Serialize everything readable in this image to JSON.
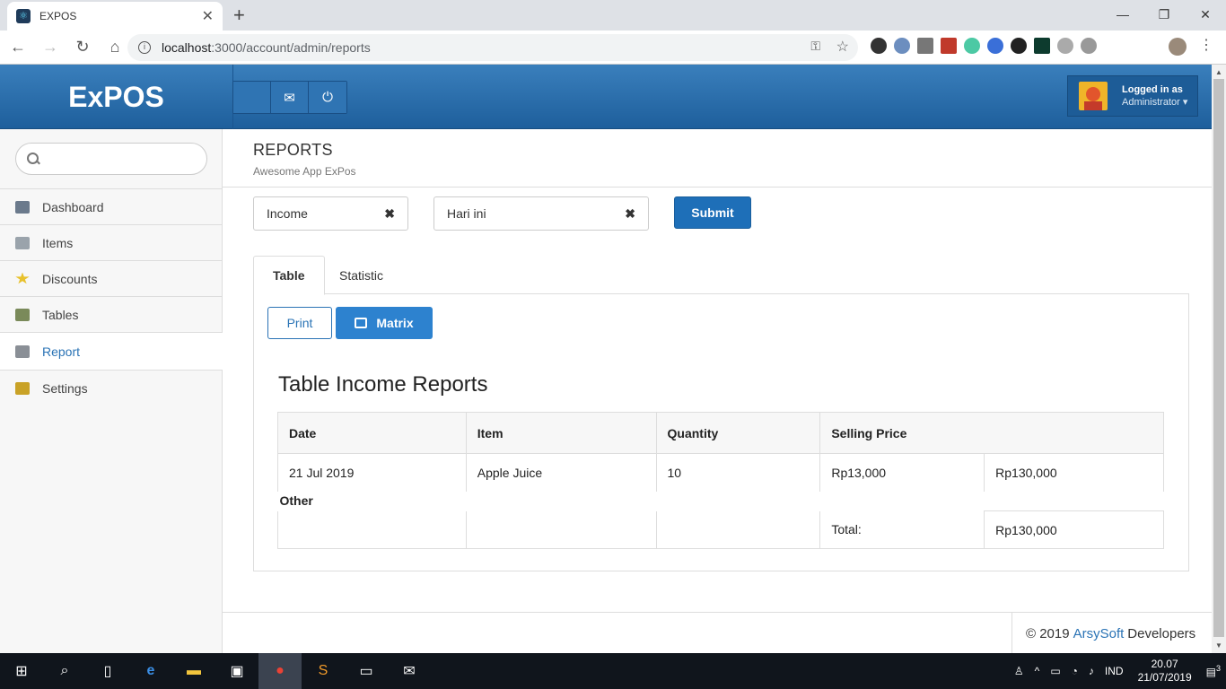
{
  "browser": {
    "tab_title": "EXPOS",
    "tab_close": "✕",
    "new_tab": "+",
    "url_host": "localhost",
    "url_path": ":3000/account/admin/reports",
    "window_controls": [
      "—",
      "❐",
      "✕"
    ]
  },
  "header": {
    "brand": "ExPOS",
    "buttons": [
      "",
      "envelope-icon",
      "power-icon"
    ],
    "user_label": "Logged in as",
    "user_role": "Administrator ▾"
  },
  "sidebar": {
    "search_placeholder": "",
    "items": [
      {
        "label": "Dashboard",
        "icon": "monitor-icon",
        "color": "#6b7a8c"
      },
      {
        "label": "Items",
        "icon": "items-icon",
        "color": "#9aa3ab"
      },
      {
        "label": "Discounts",
        "icon": "star-icon",
        "color": "#e8c12c"
      },
      {
        "label": "Tables",
        "icon": "picture-icon",
        "color": "#7a8a5a"
      },
      {
        "label": "Report",
        "icon": "report-icon",
        "color": "#8a8f96"
      },
      {
        "label": "Settings",
        "icon": "lock-icon",
        "color": "#c9a227"
      }
    ],
    "active_index": 4
  },
  "page": {
    "title": "REPORTS",
    "subtitle": "Awesome App ExPos"
  },
  "filters": {
    "type_value": "Income",
    "period_value": "Hari ini",
    "clear_symbol": "✖",
    "submit_label": "Submit"
  },
  "tabs": [
    "Table",
    "Statistic"
  ],
  "actions": {
    "print_label": "Print",
    "matrix_label": "Matrix"
  },
  "report": {
    "title": "Table Income Reports",
    "columns": [
      "Date",
      "Item",
      "Quantity",
      "Selling Price"
    ],
    "rows": [
      {
        "date": "21 Jul 2019",
        "item": "Apple Juice",
        "quantity": "10",
        "price": "Rp13,000",
        "subtotal": "Rp130,000"
      }
    ],
    "group_label": "Other",
    "total_label": "Total:",
    "total_value": "Rp130,000"
  },
  "footer": {
    "copyright": "© 2019",
    "company": "ArsySoft",
    "suffix": "Developers"
  },
  "taskbar": {
    "language": "IND",
    "time": "20.07",
    "date": "21/07/2019",
    "notifications": "3"
  },
  "colors": {
    "header_blue": "#2a73b5",
    "submit_blue": "#1e6fb8",
    "link_blue": "#2a73b5"
  }
}
